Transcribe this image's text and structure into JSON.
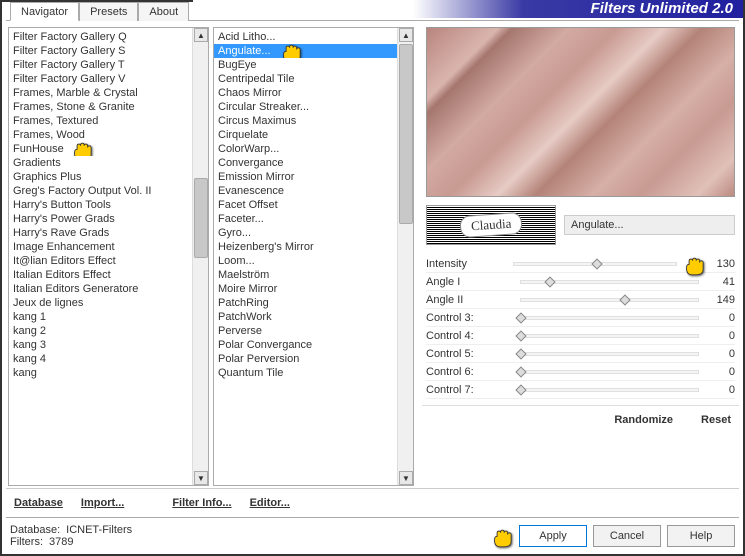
{
  "app": {
    "title": "Filters Unlimited 2.0"
  },
  "tabs": {
    "navigator": "Navigator",
    "presets": "Presets",
    "about": "About",
    "active": "navigator"
  },
  "leftList": {
    "items": [
      "Filter Factory Gallery Q",
      "Filter Factory Gallery S",
      "Filter Factory Gallery T",
      "Filter Factory Gallery V",
      "Frames, Marble & Crystal",
      "Frames, Stone & Granite",
      "Frames, Textured",
      "Frames, Wood",
      "FunHouse",
      "Gradients",
      "Graphics Plus",
      "Greg's Factory Output Vol. II",
      "Harry's Button Tools",
      "Harry's Power Grads",
      "Harry's Rave Grads",
      "Image Enhancement",
      "It@lian Editors Effect",
      "Italian Editors Effect",
      "Italian Editors Generatore",
      "Jeux de lignes",
      "kang 1",
      "kang 2",
      "kang 3",
      "kang 4",
      "kang"
    ],
    "pointerIndex": 8
  },
  "rightList": {
    "items": [
      "Acid Litho...",
      "Angulate...",
      "BugEye",
      "Centripedal Tile",
      "Chaos Mirror",
      "Circular Streaker...",
      "Circus Maximus",
      "Cirquelate",
      "ColorWarp...",
      "Convergance",
      "Emission Mirror",
      "Evanescence",
      "Facet Offset",
      "Faceter...",
      "Gyro...",
      "Heizenberg's Mirror",
      "Loom...",
      "Maelström",
      "Moire Mirror",
      "PatchRing",
      "PatchWork",
      "Perverse",
      "Polar Convergance",
      "Polar Perversion",
      "Quantum Tile"
    ],
    "selectedIndex": 1,
    "pointerIndex": 1
  },
  "midButtons": {
    "database": "Database",
    "import": "Import...",
    "filterInfo": "Filter Info...",
    "editor": "Editor..."
  },
  "logoText": "Claudia",
  "currentFilter": "Angulate...",
  "controls": [
    {
      "label": "Intensity",
      "value": 130,
      "max": 255,
      "pointer": true
    },
    {
      "label": "Angle I",
      "value": 41,
      "max": 255
    },
    {
      "label": "Angle II",
      "value": 149,
      "max": 255
    },
    {
      "label": "Control 3:",
      "value": 0,
      "max": 255
    },
    {
      "label": "Control 4:",
      "value": 0,
      "max": 255
    },
    {
      "label": "Control 5:",
      "value": 0,
      "max": 255
    },
    {
      "label": "Control 6:",
      "value": 0,
      "max": 255
    },
    {
      "label": "Control 7:",
      "value": 0,
      "max": 255
    }
  ],
  "rightButtons": {
    "randomize": "Randomize",
    "reset": "Reset"
  },
  "footer": {
    "dbLabel": "Database:",
    "dbValue": "ICNET-Filters",
    "filtersLabel": "Filters:",
    "filtersValue": "3789",
    "apply": "Apply",
    "cancel": "Cancel",
    "help": "Help"
  }
}
